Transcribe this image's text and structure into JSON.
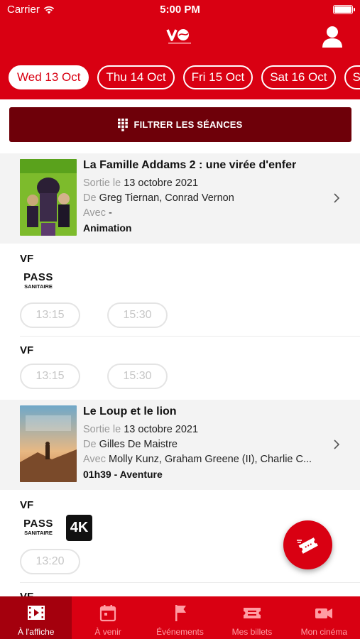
{
  "status_bar": {
    "carrier": "Carrier",
    "time": "5:00 PM"
  },
  "header": {
    "logo": "vo-logo",
    "profile_icon": "user-icon"
  },
  "days": [
    {
      "label": "Wed 13 Oct",
      "selected": true
    },
    {
      "label": "Thu 14 Oct",
      "selected": false
    },
    {
      "label": "Fri 15 Oct",
      "selected": false
    },
    {
      "label": "Sat 16 Oct",
      "selected": false
    },
    {
      "label": "Sun",
      "selected": false
    }
  ],
  "filter": {
    "label": "FILTRER LES SÉANCES",
    "icon": "grid-icon"
  },
  "movies": [
    {
      "title": "La Famille Addams 2 : une virée d'enfer",
      "release_key": "Sortie le",
      "release": "13 octobre 2021",
      "director_key": "De",
      "director": "Greg Tiernan, Conrad Vernon",
      "cast_key": "Avec",
      "cast": "-",
      "genre": "Animation",
      "showings": [
        {
          "version": "VF",
          "pass": {
            "line1": "PASS",
            "line2": "SANITAIRE"
          },
          "times": [
            "13:15",
            "15:30"
          ]
        },
        {
          "version": "VF",
          "times": [
            "13:15",
            "15:30"
          ]
        }
      ]
    },
    {
      "title": "Le Loup et le lion",
      "release_key": "Sortie le",
      "release": "13 octobre 2021",
      "director_key": "De",
      "director": "Gilles De Maistre",
      "cast_key": "Avec",
      "cast": "Molly Kunz, Graham Greene (II), Charlie C...",
      "genre": "01h39 - Aventure",
      "showings": [
        {
          "version": "VF",
          "pass": {
            "line1": "PASS",
            "line2": "SANITAIRE"
          },
          "badge": "4K",
          "times": [
            "13:20"
          ]
        },
        {
          "version": "VF"
        }
      ]
    }
  ],
  "fab": {
    "icon": "ticket-plane-icon"
  },
  "tabs": [
    {
      "label": "À l'affiche",
      "icon": "film-icon",
      "active": true
    },
    {
      "label": "À venir",
      "icon": "calendar-icon",
      "active": false
    },
    {
      "label": "Événements",
      "icon": "flag-icon",
      "active": false
    },
    {
      "label": "Mes billets",
      "icon": "ticket-icon",
      "active": false
    },
    {
      "label": "Mon cinéma",
      "icon": "camera-icon",
      "active": false
    }
  ],
  "colors": {
    "brand_red": "#d90012",
    "dark_red": "#6e0009",
    "active_tab": "#a4000d"
  }
}
